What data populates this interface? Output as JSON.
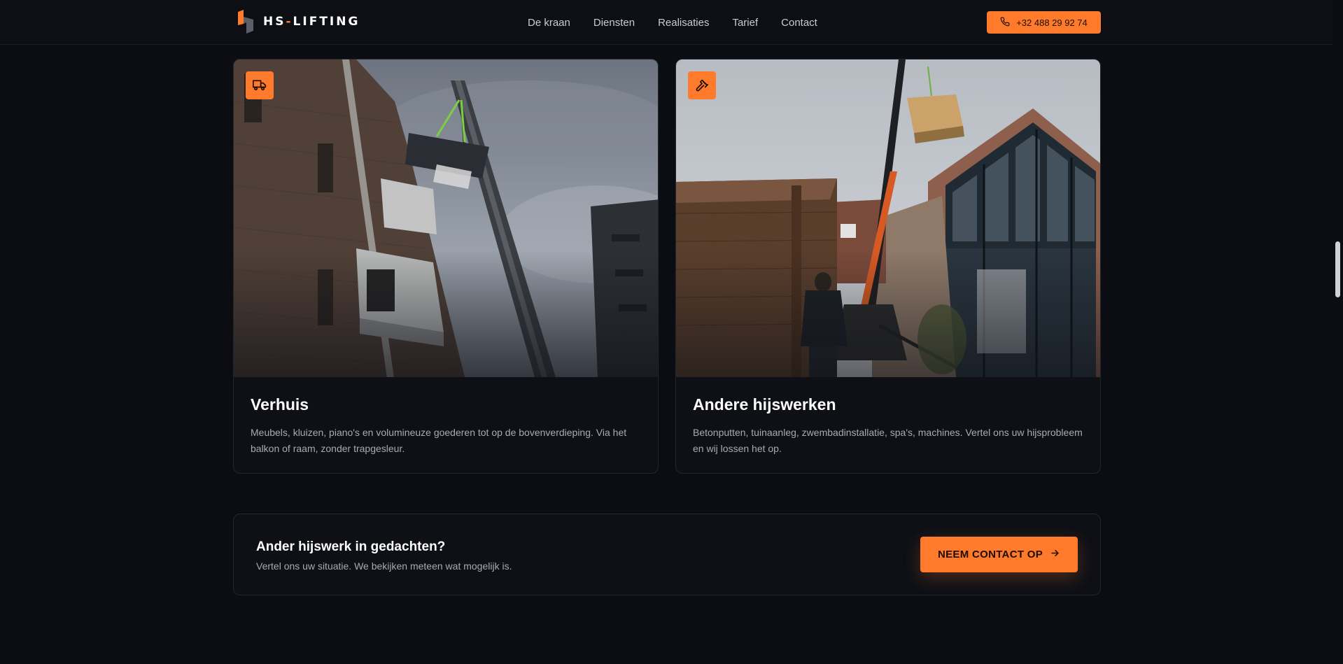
{
  "header": {
    "logo": {
      "prefix": "HS",
      "dash": "-",
      "suffix": "LIFTING"
    },
    "nav": [
      "De kraan",
      "Diensten",
      "Realisaties",
      "Tarief",
      "Contact"
    ],
    "phone_label": "+32 488 29 92 74"
  },
  "cards": [
    {
      "icon": "truck-icon",
      "title": "Verhuis",
      "description": "Meubels, kluizen, piano's en volumineuze goederen tot op de bovenverdieping. Via het balkon of raam, zonder trapgesleur."
    },
    {
      "icon": "hammer-icon",
      "title": "Andere hijswerken",
      "description": "Betonputten, tuinaanleg, zwembadinstallatie, spa's, machines. Vertel ons uw hijsprobleem en wij lossen het op."
    }
  ],
  "cta": {
    "title": "Ander hijswerk in gedachten?",
    "subtitle": "Vertel ons uw situatie. We bekijken meteen wat mogelijk is.",
    "button_label": "NEEM CONTACT OP"
  },
  "colors": {
    "accent": "#ff7a2a",
    "background": "#0b0d12",
    "card": "#0e1016"
  }
}
